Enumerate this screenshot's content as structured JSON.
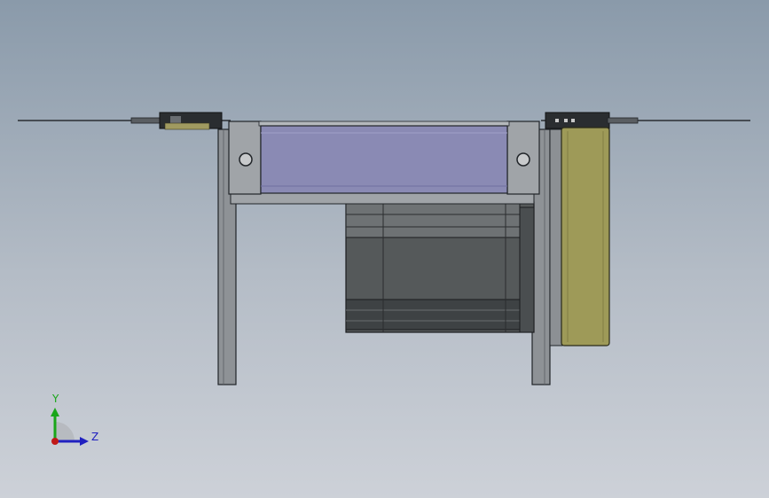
{
  "viewport": {
    "background_top": "#8a9aaa",
    "background_bottom": "#cdd1d8"
  },
  "model": {
    "colors": {
      "conveyor_belt": "#8a8ab4",
      "conveyor_frame": "#a0a4a8",
      "motor_body": "#55595a",
      "gearbox_panel": "#9e9a58",
      "outline": "#202428",
      "leg": "#8e9296"
    }
  },
  "triad": {
    "y_label": "Y",
    "z_label": "Z",
    "y_color": "#19a619",
    "z_color": "#2020c0",
    "origin_color": "#c01818"
  }
}
